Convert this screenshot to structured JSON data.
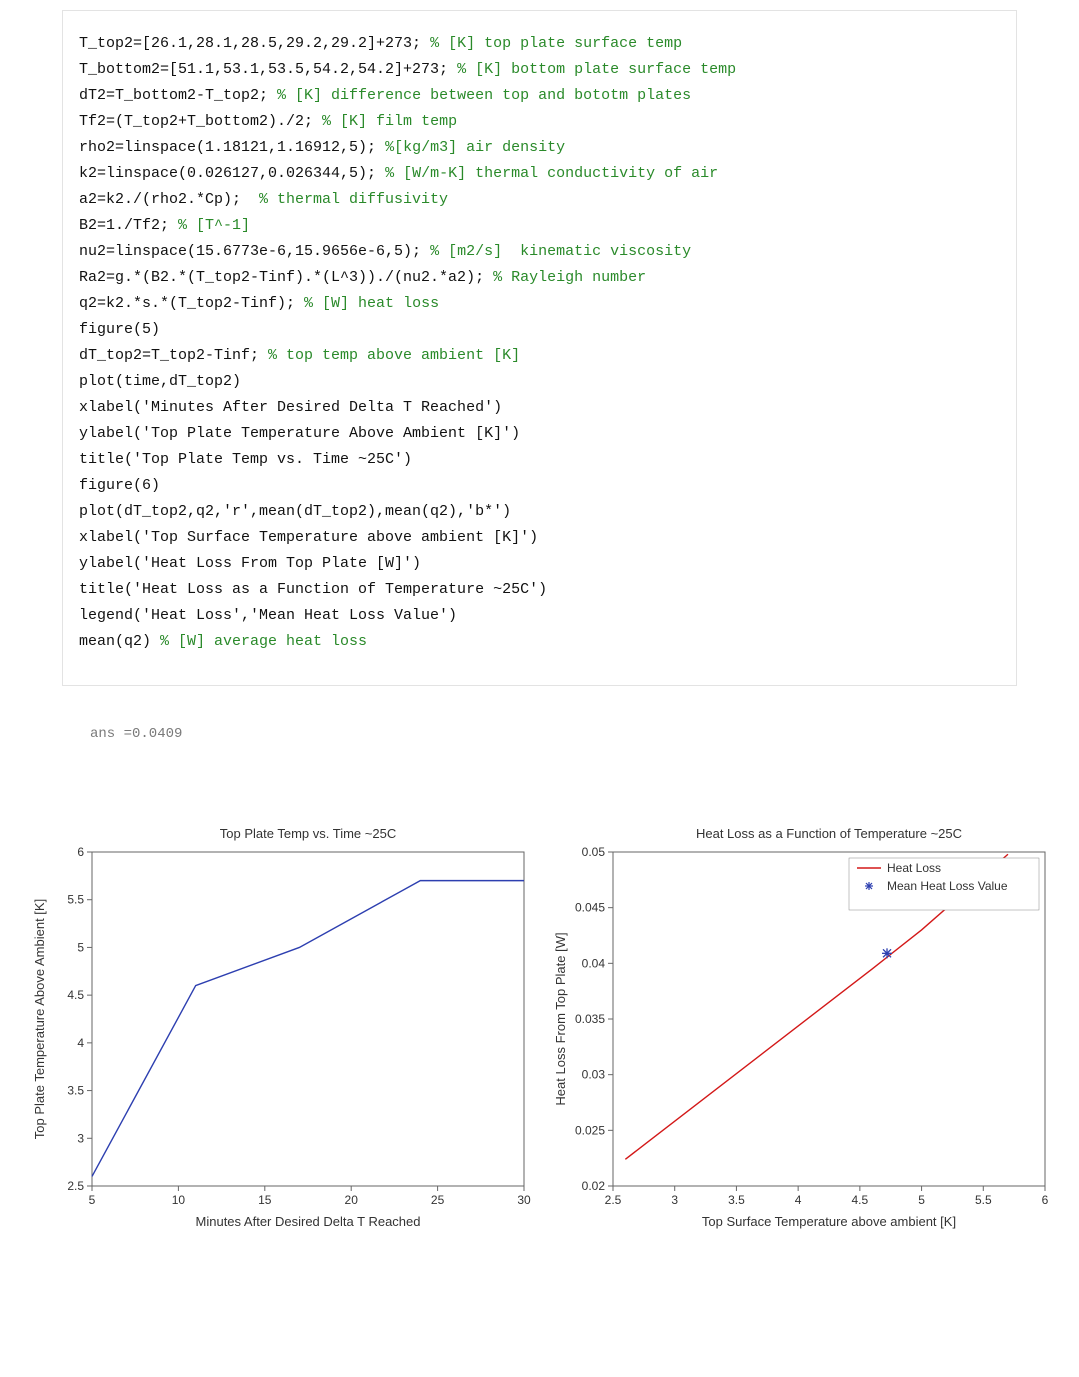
{
  "code_lines": [
    {
      "code": "T_top2=[26.1,28.1,28.5,29.2,29.2]+273; ",
      "comment": "% [K] top plate surface temp"
    },
    {
      "code": "T_bottom2=[51.1,53.1,53.5,54.2,54.2]+273; ",
      "comment": "% [K] bottom plate surface temp"
    },
    {
      "code": "dT2=T_bottom2-T_top2; ",
      "comment": "% [K] difference between top and bototm plates"
    },
    {
      "code": "Tf2=(T_top2+T_bottom2)./2; ",
      "comment": "% [K] film temp"
    },
    {
      "code": "rho2=linspace(1.18121,1.16912,5); ",
      "comment": "%[kg/m3] air density"
    },
    {
      "code": "k2=linspace(0.026127,0.026344,5); ",
      "comment": "% [W/m-K] thermal conductivity of air"
    },
    {
      "code": "a2=k2./(rho2.*Cp);  ",
      "comment": "% thermal diffusivity"
    },
    {
      "code": "B2=1./Tf2; ",
      "comment": "% [T^-1]"
    },
    {
      "code": "nu2=linspace(15.6773e-6,15.9656e-6,5); ",
      "comment": "% [m2/s]  kinematic viscosity"
    },
    {
      "code": "Ra2=g.*(B2.*(T_top2-Tinf).*(L^3))./(nu2.*a2); ",
      "comment": "% Rayleigh number"
    },
    {
      "code": "q2=k2.*s.*(T_top2-Tinf); ",
      "comment": "% [W] heat loss"
    },
    {
      "code": "figure(5)",
      "comment": ""
    },
    {
      "code": "dT_top2=T_top2-Tinf; ",
      "comment": "% top temp above ambient [K]"
    },
    {
      "code": "plot(time,dT_top2)",
      "comment": ""
    },
    {
      "code": "xlabel('Minutes After Desired Delta T Reached')",
      "comment": ""
    },
    {
      "code": "ylabel('Top Plate Temperature Above Ambient [K]')",
      "comment": ""
    },
    {
      "code": "title('Top Plate Temp vs. Time ~25C')",
      "comment": ""
    },
    {
      "code": "figure(6)",
      "comment": ""
    },
    {
      "code": "plot(dT_top2,q2,'r',mean(dT_top2),mean(q2),'b*')",
      "comment": ""
    },
    {
      "code": "xlabel('Top Surface Temperature above ambient [K]')",
      "comment": ""
    },
    {
      "code": "ylabel('Heat Loss From Top Plate [W]')",
      "comment": ""
    },
    {
      "code": "title('Heat Loss as a Function of Temperature ~25C')",
      "comment": ""
    },
    {
      "code": "legend('Heat Loss','Mean Heat Loss Value')",
      "comment": ""
    },
    {
      "code": "mean(q2) ",
      "comment": "% [W] average heat loss"
    }
  ],
  "output_line": "ans =0.0409",
  "chart_data": [
    {
      "type": "line",
      "title": "Top Plate Temp vs. Time ~25C",
      "xlabel": "Minutes After Desired Delta T Reached",
      "ylabel": "Top Plate Temperature Above Ambient [K]",
      "x_ticks": [
        5,
        10,
        15,
        20,
        25,
        30
      ],
      "y_ticks": [
        2.5,
        3,
        3.5,
        4,
        4.5,
        5,
        5.5,
        6
      ],
      "xlim": [
        5,
        30
      ],
      "ylim": [
        2.5,
        6
      ],
      "series": [
        {
          "name": "dT_top2",
          "color": "#2d3fb0",
          "x": [
            5,
            11,
            17,
            24,
            30
          ],
          "y": [
            2.6,
            4.6,
            5.0,
            5.7,
            5.7
          ]
        }
      ]
    },
    {
      "type": "line",
      "title": "Heat Loss as a Function of Temperature ~25C",
      "xlabel": "Top Surface Temperature above ambient [K]",
      "ylabel": "Heat Loss From Top Plate [W]",
      "x_ticks": [
        2.5,
        3,
        3.5,
        4,
        4.5,
        5,
        5.5,
        6
      ],
      "y_ticks": [
        0.02,
        0.025,
        0.03,
        0.035,
        0.04,
        0.045,
        0.05
      ],
      "xlim": [
        2.5,
        6
      ],
      "ylim": [
        0.02,
        0.05
      ],
      "series": [
        {
          "name": "Heat Loss",
          "color": "#d31818",
          "x": [
            2.6,
            4.6,
            5.0,
            5.7,
            5.7
          ],
          "y": [
            0.0224,
            0.0395,
            0.043,
            0.0498,
            0.0498
          ]
        }
      ],
      "markers": [
        {
          "name": "Mean Heat Loss Value",
          "color": "#2d3fb0",
          "shape": "star",
          "x": 4.72,
          "y": 0.0409
        }
      ],
      "legend": {
        "position": "top-right",
        "entries": [
          "Heat Loss",
          "Mean Heat Loss Value"
        ]
      }
    }
  ]
}
